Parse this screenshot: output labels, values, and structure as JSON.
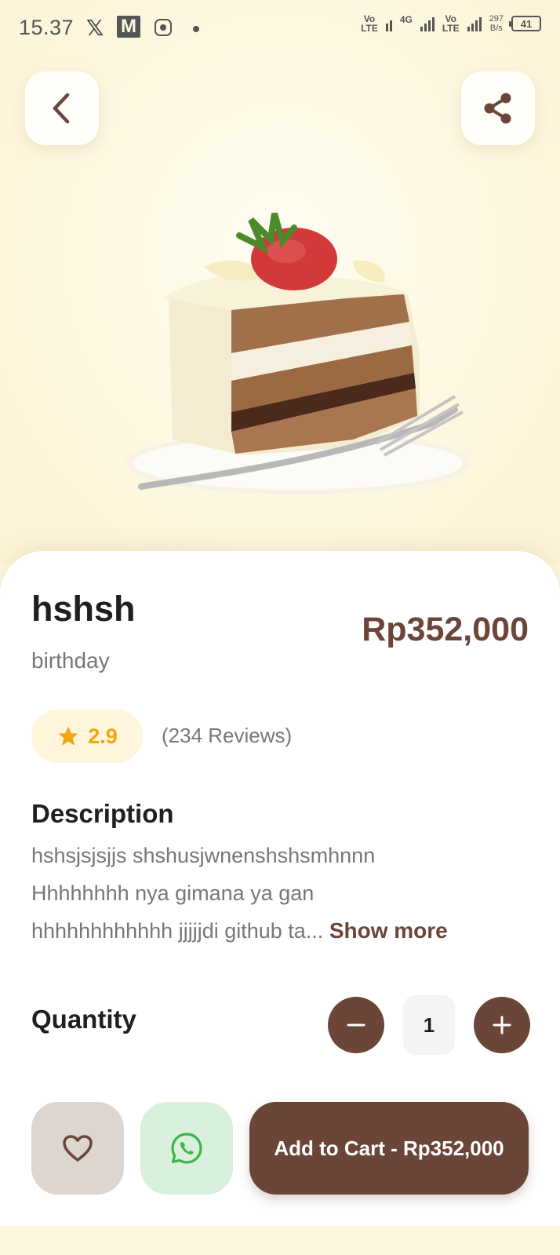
{
  "status_bar": {
    "time": "15.37",
    "x_glyph": "𝕏",
    "m_glyph": "M",
    "net1": "Vo\nLTE",
    "net2": "4G",
    "net3": "Vo\nLTE",
    "speed_value": "297",
    "speed_unit": "B/s",
    "battery": "41"
  },
  "product": {
    "name": "hshsh",
    "category": "birthday",
    "price": "Rp352,000",
    "rating": "2.9",
    "reviews": "(234 Reviews)",
    "description_heading": "Description",
    "description_line1": "hshsjsjsjjs shshusjwnenshshsmhnnn",
    "description_line2": "Hhhhhhhh nya gimana ya gan",
    "description_line3": "hhhhhhhhhhhh jjjjjdi github ta",
    "ellipsis": "...",
    "show_more": "Show more",
    "quantity_label": "Quantity",
    "quantity": "1",
    "add_to_cart": "Add to Cart - Rp352,000"
  },
  "colors": {
    "accent": "#6b4638",
    "star": "#f2a60d",
    "whatsapp": "#3cb44b",
    "background": "#fdf7df"
  },
  "icons": [
    "back-arrow-icon",
    "share-icon",
    "star-icon",
    "minus-icon",
    "plus-icon",
    "heart-icon",
    "whatsapp-icon"
  ]
}
